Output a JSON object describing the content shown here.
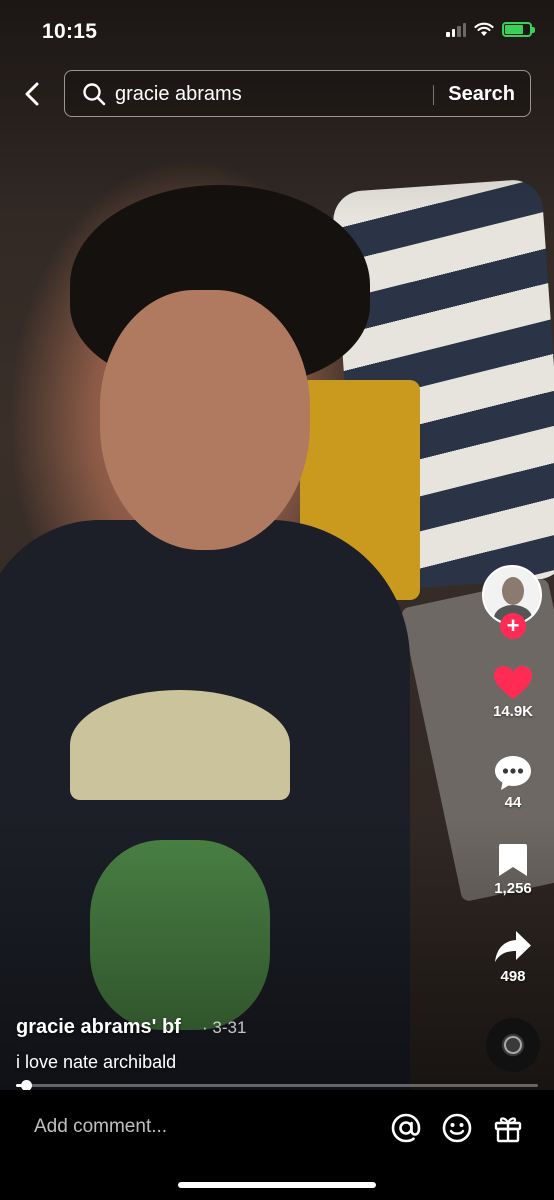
{
  "status": {
    "time": "10:15"
  },
  "search": {
    "query": "gracie abrams",
    "button_label": "Search"
  },
  "actions": {
    "likes": "14.9K",
    "comments": "44",
    "saves": "1,256",
    "shares": "498"
  },
  "post": {
    "author": "gracie abrams' bf",
    "date": "· 3-31",
    "caption": "i love nate archibald",
    "progress": 0.02
  },
  "comment_bar": {
    "placeholder": "Add comment..."
  },
  "icons": {
    "back": "chevron-left-icon",
    "search": "search-icon",
    "like": "heart-icon",
    "comment": "comment-bubble-icon",
    "save": "bookmark-icon",
    "share": "share-arrow-icon",
    "mention": "at-icon",
    "emoji": "smiley-icon",
    "gift": "gift-icon"
  },
  "colors": {
    "like": "#fe2c55",
    "follow": "#fe2c55",
    "battery": "#3ad15a"
  }
}
